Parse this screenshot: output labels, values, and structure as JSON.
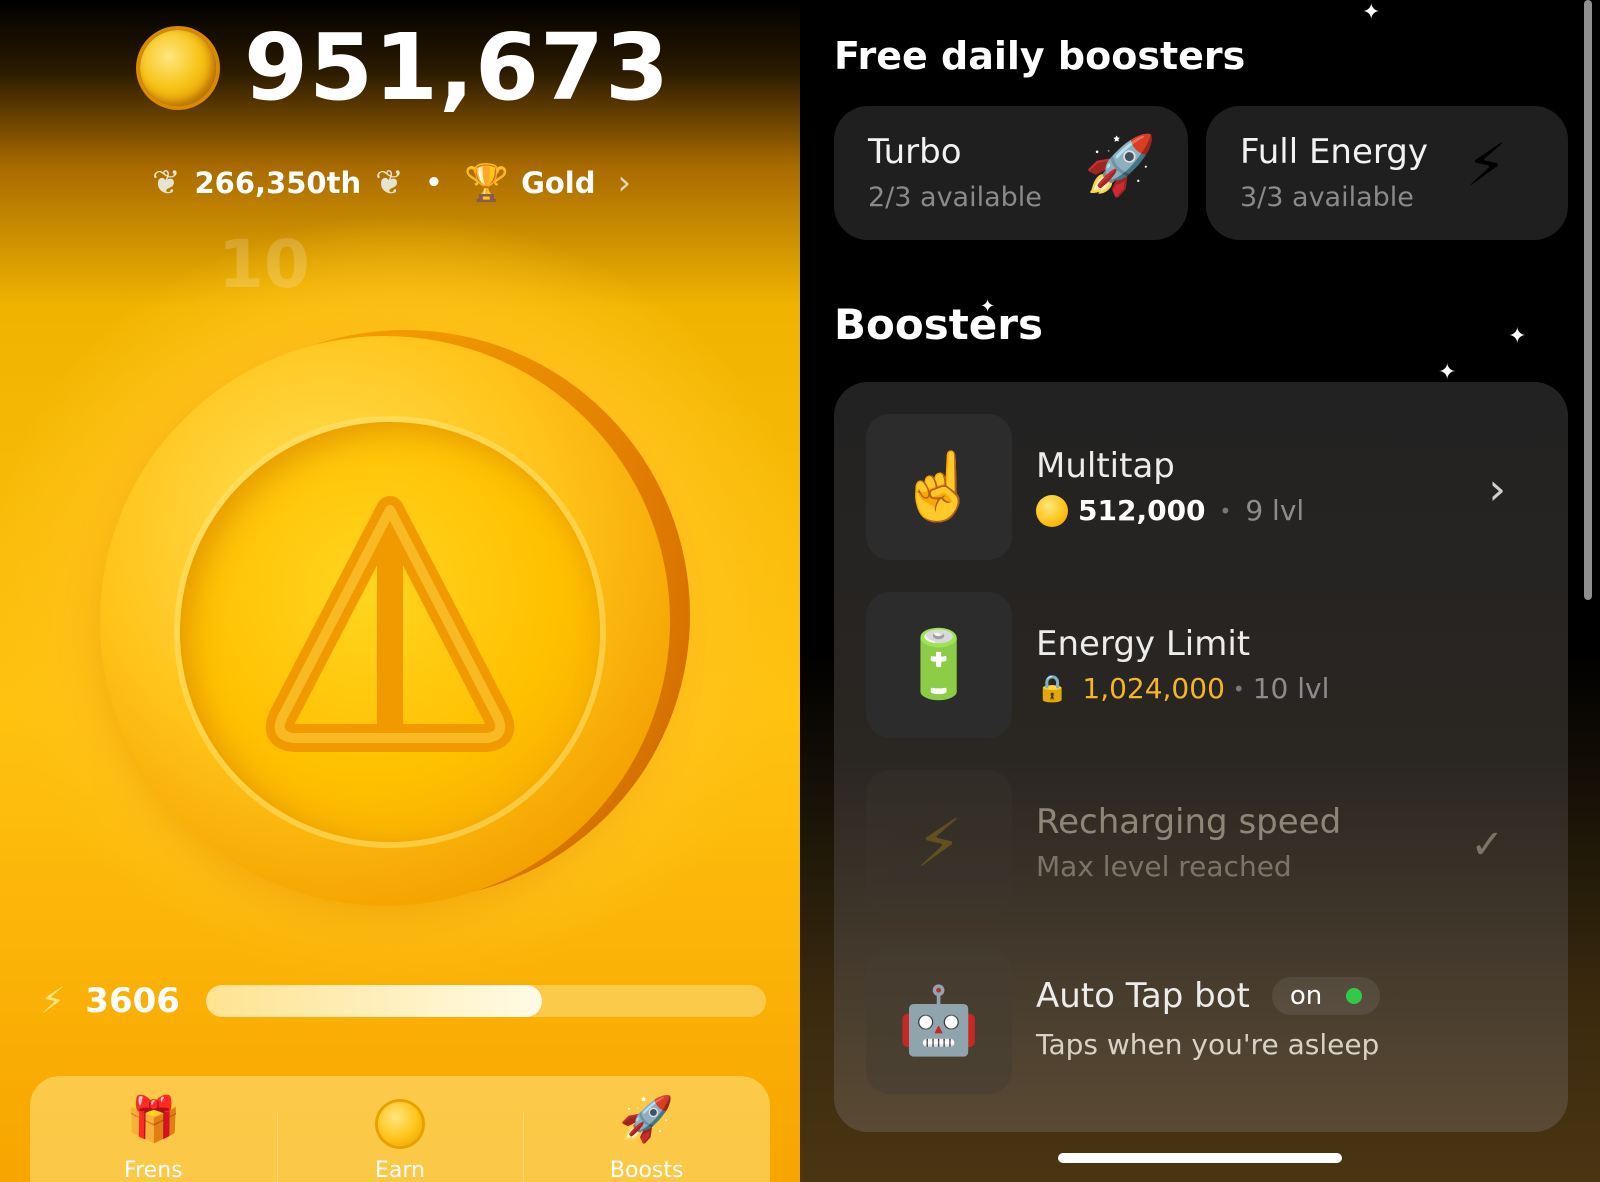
{
  "left": {
    "balance": "951,673",
    "rank": "266,350th",
    "league": "Gold",
    "floating_tap": "10",
    "energy": "3606",
    "energy_fraction": 0.6,
    "nav": [
      {
        "label": "Frens",
        "icon": "gift-icon"
      },
      {
        "label": "Earn",
        "icon": "coin-icon"
      },
      {
        "label": "Boosts",
        "icon": "rocket-icon"
      }
    ]
  },
  "right": {
    "daily_title": "Free daily boosters",
    "daily": [
      {
        "title": "Turbo",
        "sub": "2/3 available",
        "icon": "rocket-icon"
      },
      {
        "title": "Full Energy",
        "sub": "3/3 available",
        "icon": "lightning-icon"
      }
    ],
    "boosters_title": "Boosters",
    "boosters": [
      {
        "title": "Multitap",
        "price": "512,000",
        "level": "9 lvl",
        "icon": "pointing-finger-icon"
      },
      {
        "title": "Energy Limit",
        "price": "1,024,000",
        "level": "10 lvl",
        "icon": "battery-icon"
      },
      {
        "title": "Recharging speed",
        "sub": "Max level reached",
        "icon": "lightning-icon"
      },
      {
        "title": "Auto Tap bot",
        "badge": "on",
        "sub": "Taps when you're asleep",
        "icon": "robot-icon"
      }
    ]
  },
  "colors": {
    "gold": "#ffc20f",
    "price_gold": "#f5b528",
    "status_green": "#33c84a"
  }
}
